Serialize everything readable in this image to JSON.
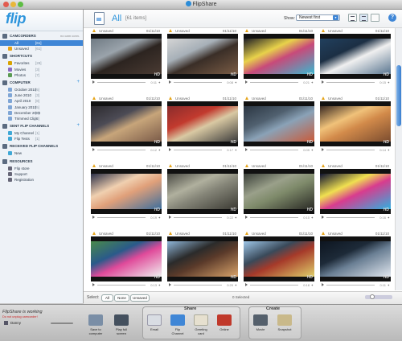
{
  "window": {
    "title": "FlipShare"
  },
  "sidebar": {
    "brand": "flip",
    "sections": [
      {
        "title": "CAMCORDERS",
        "note": "no cam conn.",
        "action": "",
        "items": [
          {
            "label": "All",
            "count": "[61]",
            "selected": true,
            "icon_color": "#3f86d6"
          },
          {
            "label": "Unsaved",
            "count": "[61]",
            "selected": false,
            "icon_color": "#e6a419"
          }
        ]
      },
      {
        "title": "SHORTCUTS",
        "note": "",
        "action": "",
        "items": [
          {
            "label": "Favorites",
            "count": "[28]",
            "selected": false,
            "icon_color": "#d9a300"
          },
          {
            "label": "Movies",
            "count": "[3]",
            "selected": false,
            "icon_color": "#8a6bc1"
          },
          {
            "label": "Photos",
            "count": "[7]",
            "selected": false,
            "icon_color": "#5a9b52"
          }
        ]
      },
      {
        "title": "COMPUTER",
        "note": "",
        "action": "+",
        "items": [
          {
            "label": "October 2010",
            "count": "[5]",
            "selected": false,
            "icon_color": "#7fa6d6"
          },
          {
            "label": "June 2010",
            "count": "[3]",
            "selected": false,
            "icon_color": "#7fa6d6"
          },
          {
            "label": "April 2010",
            "count": "[8]",
            "selected": false,
            "icon_color": "#7fa6d6"
          },
          {
            "label": "January 2010",
            "count": "[5]",
            "selected": false,
            "icon_color": "#7fa6d6"
          },
          {
            "label": "December 2009",
            "count": "[3]",
            "selected": false,
            "icon_color": "#7fa6d6"
          },
          {
            "label": "Trimmed Clips",
            "count": "[3]",
            "selected": false,
            "icon_color": "#7fa6d6"
          }
        ]
      },
      {
        "title": "SENT FLIP CHANNELS",
        "note": "",
        "action": "+",
        "items": [
          {
            "label": "My Channel",
            "count": "[1]",
            "selected": false,
            "icon_color": "#3fa8d6"
          },
          {
            "label": "Flip Tests",
            "count": "[1]",
            "selected": false,
            "icon_color": "#3fa8d6"
          }
        ]
      },
      {
        "title": "RECEIVED FLIP CHANNELS",
        "note": "",
        "action": "",
        "items": [
          {
            "label": "New",
            "count": "",
            "selected": false,
            "icon_color": "#3fa8d6"
          }
        ]
      },
      {
        "title": "RESOURCES",
        "note": "",
        "action": "",
        "items": [
          {
            "label": "Flip store",
            "count": "",
            "selected": false,
            "icon_color": "#667"
          },
          {
            "label": "Support",
            "count": "",
            "selected": false,
            "icon_color": "#667"
          },
          {
            "label": "Registration",
            "count": "",
            "selected": false,
            "icon_color": "#667"
          }
        ]
      }
    ]
  },
  "toolbar": {
    "view_title": "All",
    "view_count": "[61 items]",
    "show_label": "Show:",
    "show_value": "Newest first",
    "help": "?"
  },
  "grid": {
    "tiles": [
      {
        "status": "Unsaved",
        "date": "01/11/10",
        "duration": "0:11",
        "hd": "HD",
        "palette": [
          "#6f7a83",
          "#2c2420",
          "#4a3b33",
          "#9aa3ab"
        ]
      },
      {
        "status": "Unsaved",
        "date": "01/11/10",
        "duration": "0:08",
        "hd": "HD",
        "palette": [
          "#d5d5d5",
          "#3a2e27",
          "#7a5c45",
          "#a7b0b8"
        ]
      },
      {
        "status": "Unsaved",
        "date": "01/11/10",
        "duration": "0:21",
        "hd": "HD",
        "palette": [
          "#1c1c24",
          "#c84a7a",
          "#3ab7d0",
          "#e8d24a"
        ]
      },
      {
        "status": "Unsaved",
        "date": "01/11/10",
        "duration": "0:15",
        "hd": "HD",
        "palette": [
          "#21405e",
          "#f0f0f0",
          "#5a7690",
          "#1c2f44"
        ]
      },
      {
        "status": "Unsaved",
        "date": "01/11/10",
        "duration": "0:12",
        "hd": "HD",
        "palette": [
          "#2c2a2e",
          "#c7a57a",
          "#7a5a48",
          "#4c4b55"
        ]
      },
      {
        "status": "Unsaved",
        "date": "01/11/10",
        "duration": "0:17",
        "hd": "HD",
        "palette": [
          "#8a2c2c",
          "#d9c9a3",
          "#3b3b3b",
          "#c23a2e"
        ]
      },
      {
        "status": "Unsaved",
        "date": "01/11/10",
        "duration": "0:09",
        "hd": "HD",
        "palette": [
          "#2b3642",
          "#8aa2b7",
          "#c95a3a",
          "#50606f"
        ]
      },
      {
        "status": "Unsaved",
        "date": "01/11/10",
        "duration": "0:14",
        "hd": "HD",
        "palette": [
          "#3a2a22",
          "#d28a4a",
          "#7b4c2f",
          "#f0c27a"
        ]
      },
      {
        "status": "Unsaved",
        "date": "01/11/10",
        "duration": "0:19",
        "hd": "HD",
        "palette": [
          "#2b2f46",
          "#e0a07a",
          "#3c6e9c",
          "#f0d0b0"
        ]
      },
      {
        "status": "Unsaved",
        "date": "01/11/10",
        "duration": "0:22",
        "hd": "HD",
        "palette": [
          "#4a4a44",
          "#858578",
          "#3b3a33",
          "#b0b09e"
        ]
      },
      {
        "status": "Unsaved",
        "date": "01/11/10",
        "duration": "0:10",
        "hd": "HD",
        "palette": [
          "#3a3f39",
          "#7e8a6a",
          "#2a2a25",
          "#9aa08a"
        ]
      },
      {
        "status": "Unsaved",
        "date": "01/11/10",
        "duration": "0:16",
        "hd": "HD",
        "palette": [
          "#0e1130",
          "#d83c8e",
          "#2fb0e0",
          "#f0e050"
        ]
      },
      {
        "status": "Unsaved",
        "date": "01/11/10",
        "duration": "0:13",
        "hd": "HD",
        "palette": [
          "#4a8a4a",
          "#e04a9a",
          "#f0f0f0",
          "#2a5a8a"
        ]
      },
      {
        "status": "Unsaved",
        "date": "01/11/10",
        "duration": "0:20",
        "hd": "HD",
        "palette": [
          "#8fb6d9",
          "#5a3a2a",
          "#d9a36a",
          "#2b2b2b"
        ]
      },
      {
        "status": "Unsaved",
        "date": "01/11/10",
        "duration": "0:18",
        "hd": "HD",
        "palette": [
          "#9ec6e8",
          "#a63a2a",
          "#e0d06a",
          "#3a4a5a"
        ]
      },
      {
        "status": "Unsaved",
        "date": "01/11/10",
        "duration": "0:11",
        "hd": "HD",
        "palette": [
          "#0d1520",
          "#6a7f94",
          "#e0e6ee",
          "#1d2a38"
        ]
      }
    ]
  },
  "selbar": {
    "label": "Select:",
    "all": "All",
    "none": "None",
    "unsaved": "Unsaved",
    "selected": "0 Selected"
  },
  "bottom": {
    "working": "FlipShare is working",
    "working_sub": "Do not unplug camcorder!",
    "device_name": "Danny",
    "actions": [
      {
        "label": "Save to computer",
        "color": "#7a8ea6"
      },
      {
        "label": "Play full screen",
        "color": "#44505e"
      }
    ],
    "share_title": "Share",
    "share": [
      {
        "label": "Email",
        "color": "#d9dde3"
      },
      {
        "label": "Flip Channel",
        "color": "#3f86d6"
      },
      {
        "label": "Greeting card",
        "color": "#e6e0cf"
      },
      {
        "label": "Online",
        "color": "#c0392b"
      }
    ],
    "create_title": "Create",
    "create": [
      {
        "label": "Movie",
        "color": "#55606c"
      },
      {
        "label": "Snapshot",
        "color": "#c9b98a"
      }
    ]
  }
}
